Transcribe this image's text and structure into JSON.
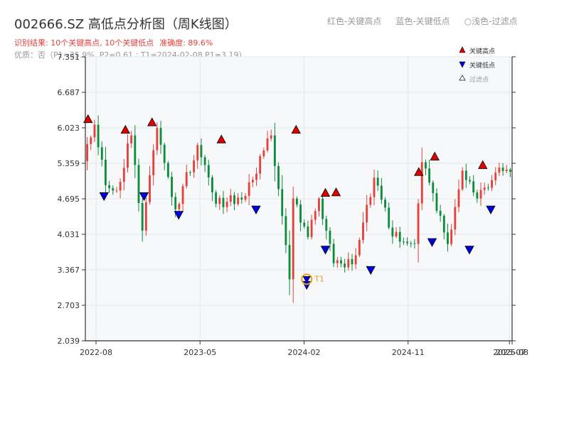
{
  "header": {
    "title": "002666.SZ 高低点分析图（周K线图）",
    "subtitle_red": "红色-关键高点",
    "subtitle_blue": "蓝色-关键低点",
    "subtitle_filtered": "○浅色-过滤点",
    "result_text": "识别结果: 10个关键高点, 10个关键低点",
    "accuracy_text": "准确度: 89.6%",
    "quality_text": "优质：否（P1=35.9%, P2=0.61 ; T1=2024-02-08 P1=3.19）"
  },
  "legend": {
    "high_label": "关键高点",
    "low_label": "关键低点",
    "filtered_label": "过滤点"
  },
  "colors": {
    "up": "#e5413a",
    "down": "#0d8c3c",
    "high_marker": "#e00000",
    "low_marker": "#0000e0",
    "t1": "#f0a020"
  },
  "chart_data": {
    "type": "candlestick",
    "timeframe": "weekly",
    "x_start": "2022-07-08",
    "x_end": "2025-08-01",
    "x_ticks": [
      {
        "date": "2022-08-05",
        "label": "2022-08"
      },
      {
        "date": "2023-05-05",
        "label": "2023-05"
      },
      {
        "date": "2024-02-02",
        "label": "2024-02"
      },
      {
        "date": "2024-11-01",
        "label": "2024-11"
      },
      {
        "date": "2025-07-25",
        "label": "2025-07"
      },
      {
        "date": "2025-08-01",
        "label": "2025-08"
      }
    ],
    "ylim": [
      2.039,
      7.351
    ],
    "y_ticks": [
      "2.039",
      "2.703",
      "3.367",
      "4.031",
      "4.695",
      "5.359",
      "6.023",
      "6.687",
      "7.351"
    ],
    "grid": true,
    "up_color": "red",
    "down_color": "green",
    "key_points": [
      5.4,
      6.08,
      4.95,
      4.85,
      5.88,
      4.1,
      6.02,
      4.5,
      5.7,
      4.6,
      4.75,
      5.88,
      3.19,
      4.7,
      3.98,
      4.7,
      3.49,
      3.47,
      5.09,
      3.99,
      3.85,
      5.38,
      4.8,
      3.85,
      5.22,
      4.7,
      4.9,
      5.28,
      5.2
    ],
    "segment_bars": [
      3,
      3,
      3,
      4,
      3,
      4,
      5,
      6,
      5,
      8,
      7,
      5,
      1,
      4,
      3,
      4,
      5,
      6,
      5,
      6,
      2,
      3,
      4,
      4,
      4,
      3,
      3,
      3
    ],
    "highs": [
      {
        "date": "2022-07-15",
        "price": 6.08
      },
      {
        "date": "2022-10-21",
        "price": 5.88
      },
      {
        "date": "2022-12-30",
        "price": 6.02
      },
      {
        "date": "2023-06-30",
        "price": 5.7
      },
      {
        "date": "2024-01-12",
        "price": 5.88
      },
      {
        "date": "2024-03-29",
        "price": 4.7
      },
      {
        "date": "2024-04-26",
        "price": 4.71
      },
      {
        "date": "2024-11-29",
        "price": 5.09
      },
      {
        "date": "2025-01-10",
        "price": 5.38
      },
      {
        "date": "2025-05-16",
        "price": 5.22
      }
    ],
    "lows": [
      {
        "date": "2022-08-26",
        "price": 4.85
      },
      {
        "date": "2022-12-09",
        "price": 4.85
      },
      {
        "date": "2023-03-10",
        "price": 4.5
      },
      {
        "date": "2023-09-29",
        "price": 4.6
      },
      {
        "date": "2024-02-09",
        "price": 3.19
      },
      {
        "date": "2024-03-29",
        "price": 3.85
      },
      {
        "date": "2024-07-26",
        "price": 3.47
      },
      {
        "date": "2025-01-03",
        "price": 3.99
      },
      {
        "date": "2025-04-11",
        "price": 3.85
      },
      {
        "date": "2025-06-06",
        "price": 4.6
      }
    ],
    "t1": {
      "label": "T1",
      "date": "2024-02-09",
      "price": 3.19
    }
  }
}
